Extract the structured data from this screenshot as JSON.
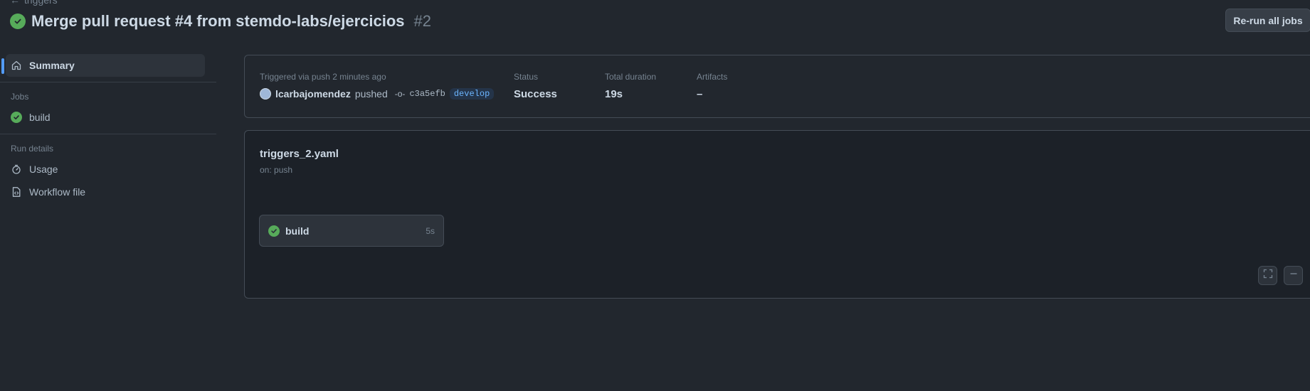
{
  "header": {
    "back_label": "triggers",
    "title": "Merge pull request #4 from stemdo-labs/ejercicios",
    "run_number": "#2",
    "rerun_label": "Re-run all jobs"
  },
  "sidebar": {
    "summary_label": "Summary",
    "jobs_heading": "Jobs",
    "jobs": [
      {
        "label": "build"
      }
    ],
    "run_details_heading": "Run details",
    "usage_label": "Usage",
    "workflow_file_label": "Workflow file"
  },
  "summary": {
    "trigger_label": "Triggered via push 2 minutes ago",
    "actor": "lcarbajomendez",
    "action": "pushed",
    "commit": "c3a5efb",
    "branch": "develop",
    "status_label": "Status",
    "status_value": "Success",
    "duration_label": "Total duration",
    "duration_value": "19s",
    "artifacts_label": "Artifacts",
    "artifacts_value": "–"
  },
  "graph": {
    "workflow_file": "triggers_2.yaml",
    "on_text": "on: push",
    "job": {
      "name": "build",
      "duration": "5s"
    }
  },
  "colors": {
    "success": "#57ab5a",
    "accent": "#539bf5",
    "background": "#22272e"
  }
}
